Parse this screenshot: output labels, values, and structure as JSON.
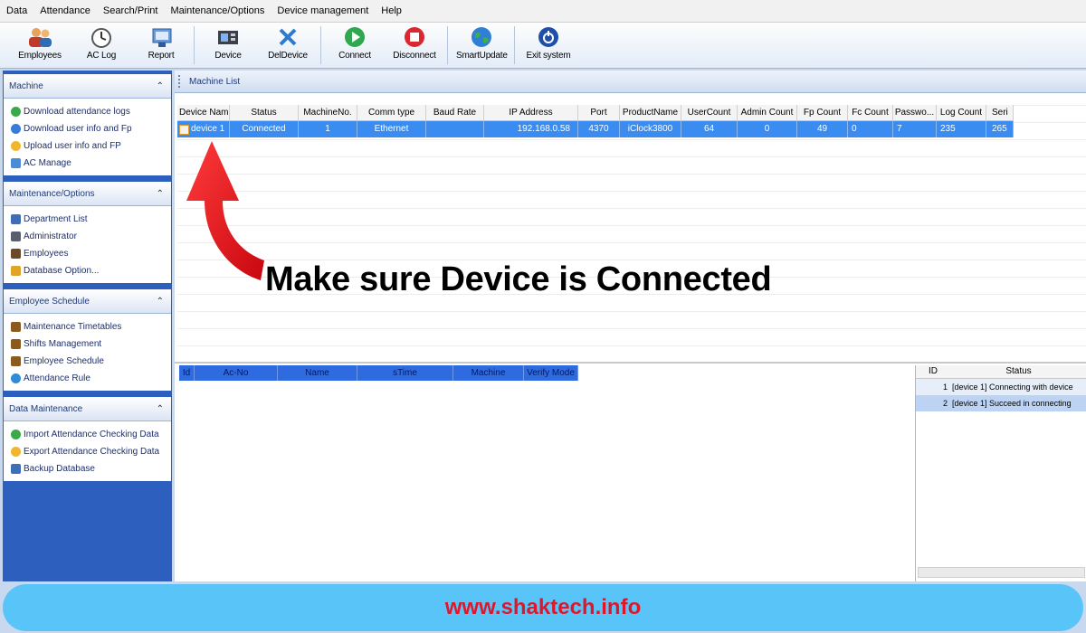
{
  "menu": [
    "Data",
    "Attendance",
    "Search/Print",
    "Maintenance/Options",
    "Device management",
    "Help"
  ],
  "toolbar": [
    {
      "label": "Employees",
      "icon": "employees-icon"
    },
    {
      "label": "AC Log",
      "icon": "clock-icon"
    },
    {
      "label": "Report",
      "icon": "report-icon"
    },
    {
      "label": "Device",
      "icon": "device-icon"
    },
    {
      "label": "DelDevice",
      "icon": "delete-icon"
    },
    {
      "label": "Connect",
      "icon": "connect-icon"
    },
    {
      "label": "Disconnect",
      "icon": "disconnect-icon"
    },
    {
      "label": "SmartUpdate",
      "icon": "globe-icon"
    },
    {
      "label": "Exit system",
      "icon": "power-icon"
    }
  ],
  "sidebar": {
    "sections": [
      {
        "title": "Machine",
        "items": [
          "Download attendance logs",
          "Download user info and Fp",
          "Upload user info and FP",
          "AC Manage"
        ]
      },
      {
        "title": "Maintenance/Options",
        "items": [
          "Department List",
          "Administrator",
          "Employees",
          "Database Option..."
        ]
      },
      {
        "title": "Employee Schedule",
        "items": [
          "Maintenance Timetables",
          "Shifts Management",
          "Employee Schedule",
          "Attendance Rule"
        ]
      },
      {
        "title": "Data Maintenance",
        "items": [
          "Import Attendance Checking Data",
          "Export Attendance Checking Data",
          "Backup Database"
        ]
      }
    ]
  },
  "machine_list": {
    "title": "Machine List",
    "columns": [
      "Device Name",
      "Status",
      "MachineNo.",
      "Comm type",
      "Baud Rate",
      "IP Address",
      "Port",
      "ProductName",
      "UserCount",
      "Admin Count",
      "Fp Count",
      "Fc Count",
      "Passwo...",
      "Log Count",
      "Seri"
    ],
    "rows": [
      [
        "device 1",
        "Connected",
        "1",
        "Ethernet",
        "",
        "192.168.0.58",
        "4370",
        "iClock3800",
        "64",
        "0",
        "49",
        "0",
        "7",
        "235",
        "265"
      ]
    ]
  },
  "log_table": {
    "columns": [
      "Id",
      "Ac-No",
      "Name",
      "sTime",
      "Machine",
      "Verify Mode"
    ]
  },
  "status_log": {
    "columns": [
      "ID",
      "Status"
    ],
    "rows": [
      {
        "id": "1",
        "status": "[device 1] Connecting with device"
      },
      {
        "id": "2",
        "status": "[device 1] Succeed in connecting"
      }
    ]
  },
  "callout": "Make sure Device is Connected",
  "banner": "www.shaktech.info",
  "colors": {
    "selected_row": "#3b8cf0",
    "arrow": "#e8131c",
    "banner_bg": "#59c4f7",
    "banner_text": "#e0162b"
  }
}
